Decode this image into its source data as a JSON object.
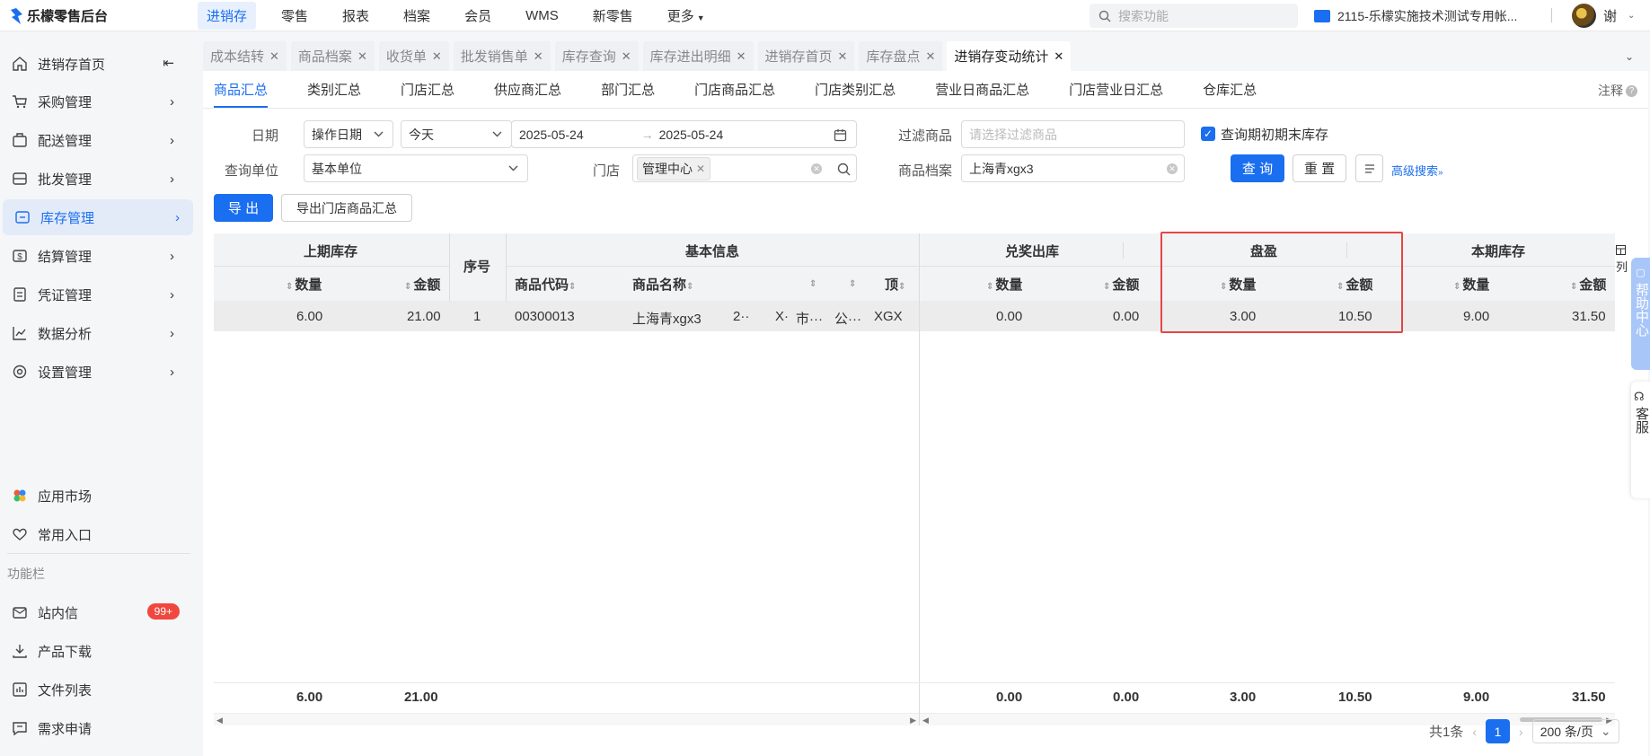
{
  "app": {
    "title": "乐檬零售后台"
  },
  "topnav": {
    "items": [
      "进销存",
      "零售",
      "报表",
      "档案",
      "会员",
      "WMS",
      "新零售",
      "更多"
    ],
    "search_placeholder": "搜索功能",
    "account": "2115-乐檬实施技术测试专用帐...",
    "user": "谢"
  },
  "sidebar": {
    "items": [
      "进销存首页",
      "采购管理",
      "配送管理",
      "批发管理",
      "库存管理",
      "结算管理",
      "凭证管理",
      "数据分析",
      "设置管理"
    ],
    "extra": [
      "应用市场",
      "常用入口"
    ],
    "section_caption": "功能栏",
    "func": [
      "站内信",
      "产品下载",
      "文件列表",
      "需求申请"
    ],
    "inbox_badge": "99+"
  },
  "tabs": [
    "成本结转",
    "商品档案",
    "收货单",
    "批发销售单",
    "库存查询",
    "库存进出明细",
    "进销存首页",
    "库存盘点",
    "进销存变动统计"
  ],
  "subtabs": [
    "商品汇总",
    "类别汇总",
    "门店汇总",
    "供应商汇总",
    "部门汇总",
    "门店商品汇总",
    "门店类别汇总",
    "营业日商品汇总",
    "门店营业日汇总",
    "仓库汇总"
  ],
  "note_label": "注释",
  "filters": {
    "date_label": "日期",
    "date_type": "操作日期",
    "date_range_preset": "今天",
    "date_from": "2025-05-24",
    "date_arrow": "→",
    "date_to": "2025-05-24",
    "filter_goods_label": "过滤商品",
    "filter_goods_placeholder": "请选择过滤商品",
    "query_period_stock_label": "查询期初期末库存",
    "unit_label": "查询单位",
    "unit_value": "基本单位",
    "store_label": "门店",
    "store_tag": "管理中心",
    "goods_label": "商品档案",
    "goods_value": "上海青xgx3",
    "query_btn": "查 询",
    "reset_btn": "重 置",
    "advanced_link": "高级搜索"
  },
  "actions": {
    "export": "导 出",
    "export_store": "导出门店商品汇总"
  },
  "table": {
    "groups": {
      "prev": "上期库存",
      "seq": "序号",
      "basic": "基本信息",
      "award": "兑奖出库",
      "panying": "盘盈",
      "current": "本期库存"
    },
    "sub": {
      "qty": "数量",
      "amt": "金额",
      "code": "商品代码",
      "name": "商品名称",
      "col_i": "顶"
    },
    "row": {
      "prev_qty": "6.00",
      "prev_amt": "21.00",
      "seq": "1",
      "code": "00300013",
      "name": "上海青xgx3",
      "c3": "2··",
      "c4": "X·",
      "c5": "市···",
      "c6": "公···",
      "c7": "XGX",
      "award_qty": "0.00",
      "award_amt": "0.00",
      "py_qty": "3.00",
      "py_amt": "10.50",
      "cur_qty": "9.00",
      "cur_amt": "31.50"
    },
    "footer": {
      "prev_qty": "6.00",
      "prev_amt": "21.00",
      "award_qty": "0.00",
      "award_amt": "0.00",
      "py_qty": "3.00",
      "py_amt": "10.50",
      "cur_qty": "9.00",
      "cur_amt": "31.50"
    },
    "col_setting": "列"
  },
  "pager": {
    "total": "共1条",
    "page": "1",
    "size": "200 条/页"
  },
  "floats": {
    "help": "帮助中心",
    "service": "客服"
  }
}
